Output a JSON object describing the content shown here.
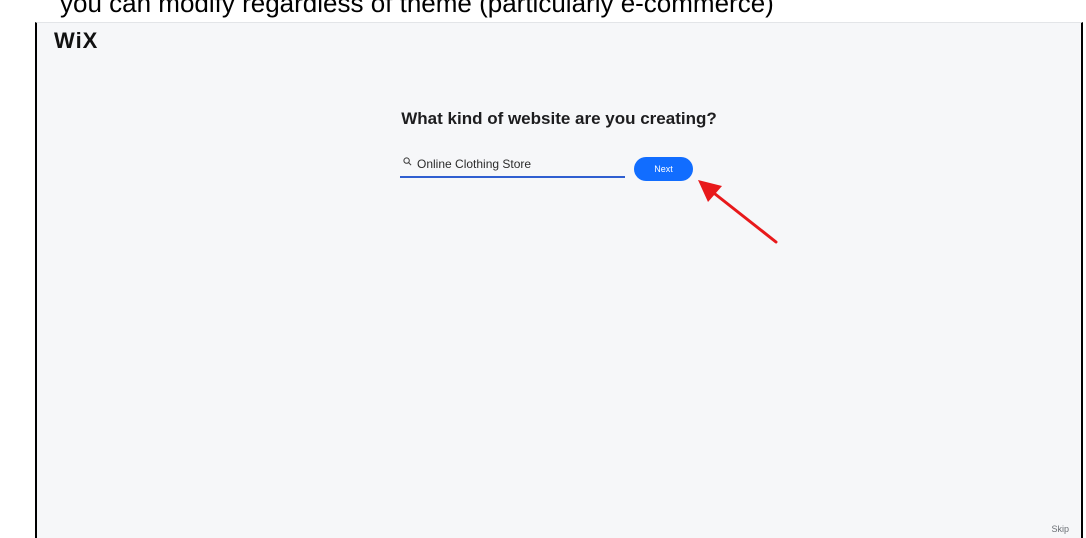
{
  "banner": {
    "text": "you can modify regardless of theme (particularly e-commerce)"
  },
  "app": {
    "logo": "WiX"
  },
  "main": {
    "heading": "What kind of website are you creating?",
    "search": {
      "value": "Online Clothing Store",
      "placeholder": ""
    },
    "next_label": "Next",
    "skip_label": "Skip"
  },
  "annotation": {
    "arrow_color": "#e8191b",
    "points_to": "next-button"
  },
  "colors": {
    "accent": "#116dff",
    "input_underline": "#2f5fd1",
    "page_background": "#f6f7f9"
  },
  "icons": {
    "search": "search-icon",
    "annotation": "red-arrow-icon"
  }
}
